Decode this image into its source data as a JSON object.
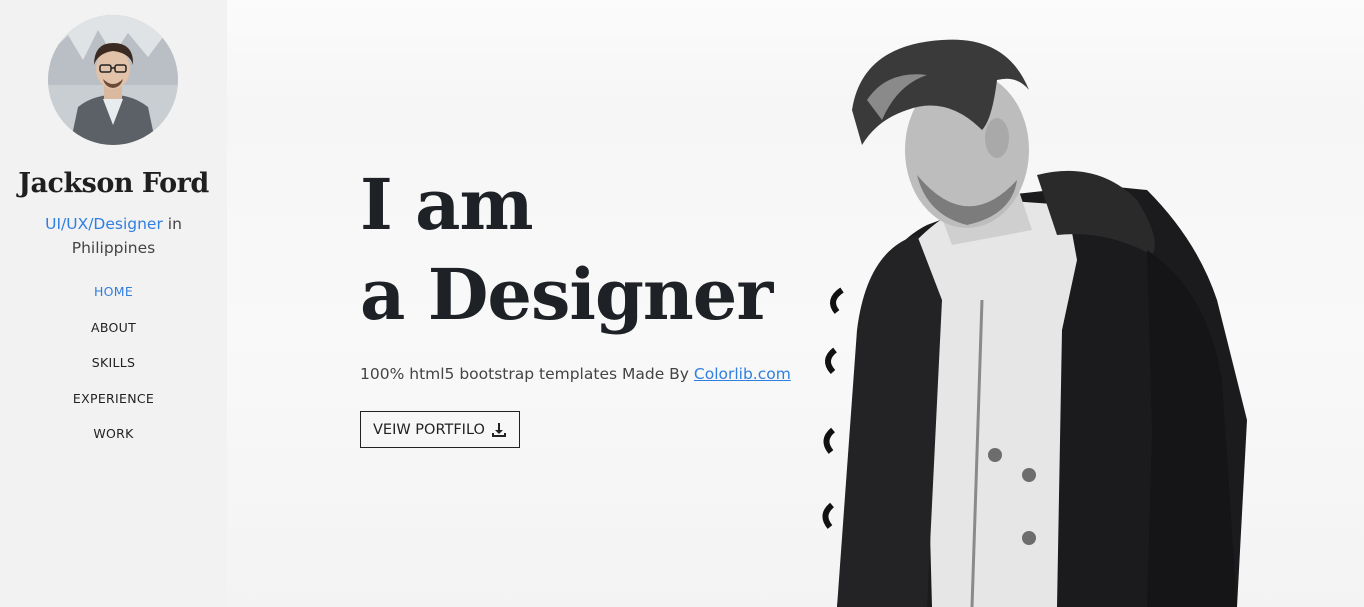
{
  "sidebar": {
    "name": "Jackson Ford",
    "role_accent": "UI/UX/Designer",
    "role_rest": " in",
    "location": "Philippines",
    "nav": [
      {
        "label": "HOME",
        "active": true
      },
      {
        "label": "ABOUT",
        "active": false
      },
      {
        "label": "SKILLS",
        "active": false
      },
      {
        "label": "EXPERIENCE",
        "active": false
      },
      {
        "label": "WORK",
        "active": false
      }
    ]
  },
  "hero": {
    "headline_line1": "I am",
    "headline_line2": "a Designer",
    "tagline_prefix": "100% html5 bootstrap templates Made By ",
    "tagline_link": "Colorlib.com",
    "cta_label": "VEIW PORTFILO",
    "cta_icon": "download-icon"
  },
  "colors": {
    "accent": "#2f7fe0",
    "sidebar_bg": "#f2f2f2",
    "text_dark": "#1e2226"
  }
}
